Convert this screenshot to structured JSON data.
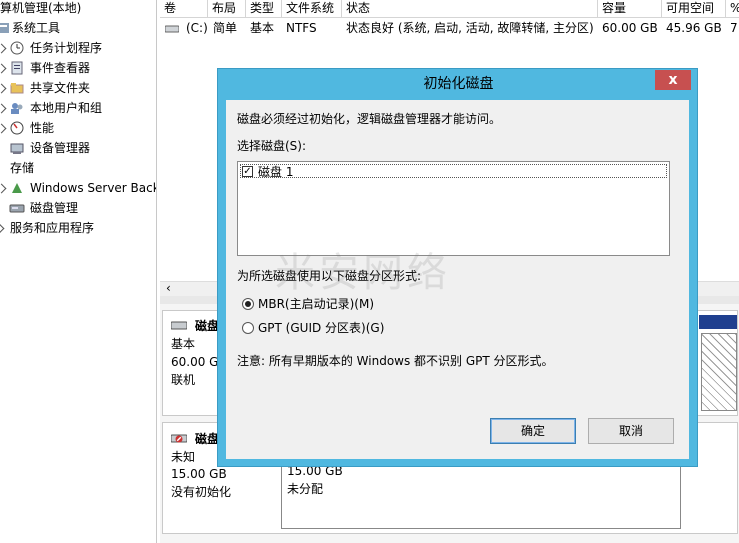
{
  "tree": {
    "items": [
      {
        "label": "算机管理(本地)",
        "icon": ""
      },
      {
        "label": "系统工具",
        "icon": "tools-icon"
      },
      {
        "label": "任务计划程序",
        "icon": "clock-icon"
      },
      {
        "label": "事件查看器",
        "icon": "event-viewer-icon"
      },
      {
        "label": "共享文件夹",
        "icon": "shared-folder-icon"
      },
      {
        "label": "本地用户和组",
        "icon": "users-icon"
      },
      {
        "label": "性能",
        "icon": "performance-icon"
      },
      {
        "label": "设备管理器",
        "icon": "device-manager-icon"
      },
      {
        "label": "存储",
        "icon": ""
      },
      {
        "label": "Windows Server Back",
        "icon": "backup-icon"
      },
      {
        "label": "磁盘管理",
        "icon": "disk-management-icon"
      },
      {
        "label": "服务和应用程序",
        "icon": ""
      }
    ]
  },
  "volume_table": {
    "headers": [
      "卷",
      "布局",
      "类型",
      "文件系统",
      "状态",
      "容量",
      "可用空间",
      "%"
    ],
    "row": {
      "volume": "(C:)",
      "layout": "简单",
      "type": "基本",
      "fs": "NTFS",
      "status": "状态良好 (系统, 启动, 活动, 故障转储, 主分区)",
      "capacity": "60.00 GB",
      "free": "45.96 GB",
      "percent": "7"
    }
  },
  "disks": [
    {
      "name": "磁盘",
      "type": "基本",
      "size": "60.00 GB",
      "state": "联机"
    },
    {
      "name": "磁盘",
      "type": "未知",
      "size": "15.00 GB",
      "state": "没有初始化",
      "partition_size": "15.00 GB",
      "partition_state": "未分配"
    }
  ],
  "dialog": {
    "title": "初始化磁盘",
    "close_glyph": "x",
    "intro": "磁盘必须经过初始化，逻辑磁盘管理器才能访问。",
    "select_label": "选择磁盘(S):",
    "disk_item": "磁盘 1",
    "partition_label": "为所选磁盘使用以下磁盘分区形式:",
    "option_mbr": "MBR(主启动记录)(M)",
    "option_gpt": "GPT (GUID 分区表)(G)",
    "note": "注意: 所有早期版本的 Windows 都不识别 GPT 分区形式。",
    "ok": "确定",
    "cancel": "取消"
  },
  "watermark": "米安网络",
  "colors": {
    "dialog_frame": "#50b8e0",
    "close_button": "#c75050",
    "disk_bar": "#1f3f8f"
  }
}
